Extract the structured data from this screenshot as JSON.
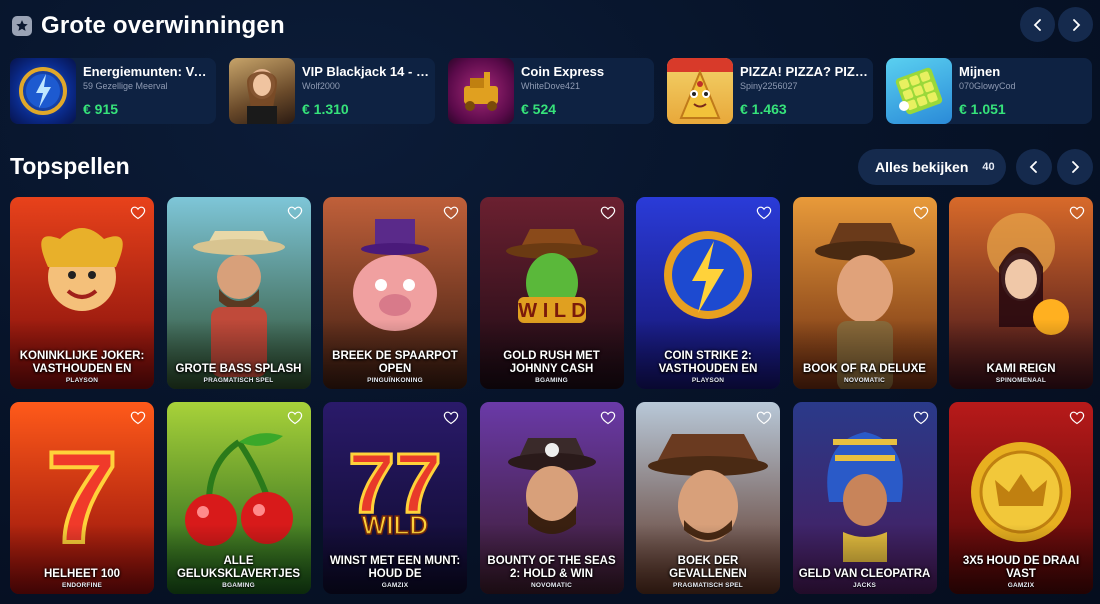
{
  "big_wins": {
    "title": "Grote overwinningen",
    "items": [
      {
        "game": "Energiemunten: Vas...",
        "user": "59 Gezellige Meerval",
        "amount": "€ 915"
      },
      {
        "game": "VIP Blackjack 14 - E...",
        "user": "Wolf2000",
        "amount": "€ 1.310"
      },
      {
        "game": "Coin Express",
        "user": "WhiteDove421",
        "amount": "€ 524"
      },
      {
        "game": "PIZZA! PIZZA? PIZZA!",
        "user": "Spiny2256027",
        "amount": "€ 1.463"
      },
      {
        "game": "Mijnen",
        "user": "070GlowyCod",
        "amount": "€ 1.051"
      }
    ]
  },
  "top_games": {
    "title": "Topspellen",
    "see_all_label": "Alles bekijken",
    "see_all_count": "40",
    "tiles": [
      {
        "name": "KONINKLIJKE JOKER: VASTHOUDEN EN",
        "provider": "PLAYSON",
        "bg": [
          "#e8421b",
          "#7a0a0a"
        ]
      },
      {
        "name": "GROTE BASS SPLASH",
        "provider": "PRAGMATISCH SPEL",
        "bg": [
          "#7ec6d8",
          "#2c4b2a"
        ]
      },
      {
        "name": "BREEK DE SPAARPOT OPEN",
        "provider": "PINGUÏNKONING",
        "bg": [
          "#c0603a",
          "#3a1b10"
        ]
      },
      {
        "name": "GOLD RUSH MET JOHNNY CASH",
        "provider": "BGAMING",
        "bg": [
          "#6b2030",
          "#1a0a14"
        ]
      },
      {
        "name": "COIN STRIKE 2: VASTHOUDEN EN",
        "provider": "PLAYSON",
        "bg": [
          "#2a3bd8",
          "#14126a"
        ]
      },
      {
        "name": "BOOK OF RA DELUXE",
        "provider": "NOVOMATIC",
        "bg": [
          "#e89a3a",
          "#6a2a10"
        ]
      },
      {
        "name": "KAMI REIGN",
        "provider": "SPINOMENAAL",
        "bg": [
          "#d86a2a",
          "#3a0f1a"
        ]
      },
      {
        "name": "HELHEET 100",
        "provider": "ENDORFINE",
        "bg": [
          "#ff5a1a",
          "#8a0a0a"
        ]
      },
      {
        "name": "ALLE GELUKSKLAVERTJES",
        "provider": "BGAMING",
        "bg": [
          "#a8d23a",
          "#1a5a1a"
        ]
      },
      {
        "name": "WINST MET EEN MUNT: HOUD DE",
        "provider": "GAMZIX",
        "bg": [
          "#2a1a6a",
          "#0d0a2a"
        ]
      },
      {
        "name": "BOUNTY OF THE SEAS 2: HOLD & WIN",
        "provider": "NOVOMATIC",
        "bg": [
          "#6a3aa8",
          "#3a1a2a"
        ]
      },
      {
        "name": "BOEK DER GEVALLENEN",
        "provider": "PRAGMATISCH SPEL",
        "bg": [
          "#b8c8d8",
          "#5a3020"
        ]
      },
      {
        "name": "GELD VAN CLEOPATRA",
        "provider": "JACKS",
        "bg": [
          "#2a3a8a",
          "#4a1a5a"
        ]
      },
      {
        "name": "3X5 HOUD DE DRAAI VAST",
        "provider": "GAMZIX",
        "bg": [
          "#b81a1a",
          "#4a0606"
        ]
      }
    ]
  },
  "colors": {
    "accent_green": "#36e27a",
    "button_bg": "#152a4d",
    "card_bg": "#0e2242"
  }
}
